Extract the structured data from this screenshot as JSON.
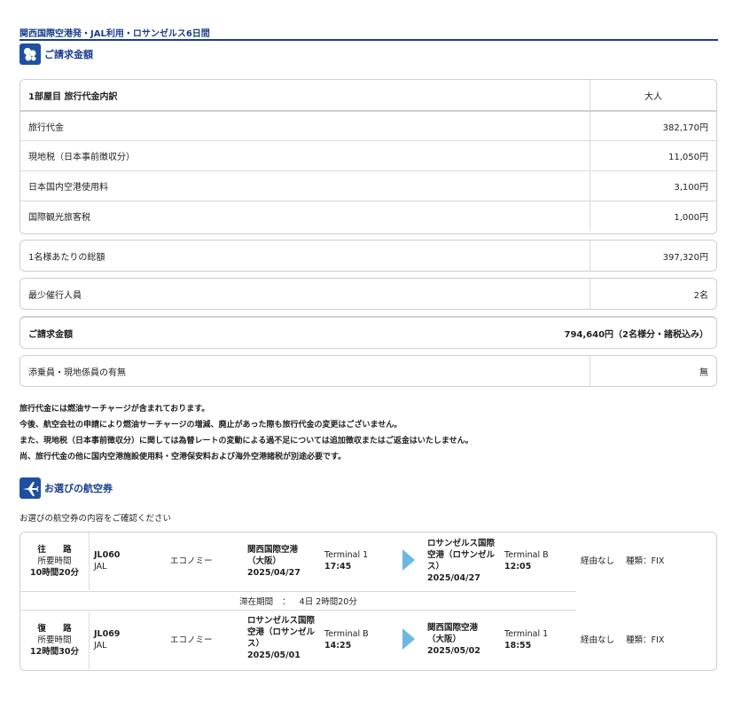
{
  "page_title": "関西国際空港発・JAL利用・ロサンゼルス6日間",
  "billing": {
    "title": "ご請求金額",
    "header": {
      "label": "1部屋目 旅行代金内訳",
      "value": "大人"
    },
    "items": [
      {
        "label": "旅行代金",
        "value": "382,170円"
      },
      {
        "label": "現地税（日本事前徴収分）",
        "value": "11,050円"
      },
      {
        "label": "日本国内空港使用料",
        "value": "3,100円"
      },
      {
        "label": "国際観光旅客税",
        "value": "1,000円"
      }
    ],
    "per_person": {
      "label": "1名様あたりの総額",
      "value": "397,320円"
    },
    "min_people": {
      "label": "最少催行人員",
      "value": "2名"
    },
    "total": {
      "label": "ご請求金額",
      "value": "794,640円（2名様分・諸税込み）"
    },
    "escort": {
      "label": "添乗員・現地係員の有無",
      "value": "無"
    }
  },
  "notes": [
    "旅行代金には燃油サーチャージが含まれております。",
    "今後、航空会社の申請により燃油サーチャージの増減、廃止があった際も旅行代金の変更はございません。",
    "また、現地税（日本事前徴収分）に関しては為替レートの変動による過不足については追加徴収またはご返金はいたしません。",
    "尚、旅行代金の他に国内空港施設使用料・空港保安料および海外空港諸税が別途必要です。"
  ],
  "flights": {
    "title": "お選びの航空券",
    "subtitle": "お選びの航空券の内容をご確認ください",
    "outbound": {
      "direction": "往 路",
      "duration_label": "所要時間",
      "duration": "10時間20分",
      "flight_no": "JL060",
      "airline": "JAL",
      "class": "エコノミー",
      "dep_airport": "関西国際空港（大阪）",
      "dep_date": "2025/04/27",
      "dep_terminal": "Terminal 1",
      "dep_time": "17:45",
      "arr_airport": "ロサンゼルス国際空港（ロサンゼルス）",
      "arr_date": "2025/04/27",
      "arr_terminal": "Terminal B",
      "arr_time": "12:05",
      "via": "経由なし",
      "fare_type": "種類：FIX"
    },
    "stay": {
      "label": "滞在期間",
      "colon": "：",
      "value": "4日 2時間20分"
    },
    "inbound": {
      "direction": "復 路",
      "duration_label": "所要時間",
      "duration": "12時間30分",
      "flight_no": "JL069",
      "airline": "JAL",
      "class": "エコノミー",
      "dep_airport": "ロサンゼルス国際空港（ロサンゼルス）",
      "dep_date": "2025/05/01",
      "dep_terminal": "Terminal B",
      "dep_time": "14:25",
      "arr_airport": "関西国際空港（大阪）",
      "arr_date": "2025/05/02",
      "arr_terminal": "Terminal 1",
      "arr_time": "18:55",
      "via": "経由なし",
      "fare_type": "種類：FIX"
    }
  },
  "colors": {
    "accent": "#1a3d8f",
    "icon_bg": "#1f4fa0",
    "arrow": "#6db7e3",
    "border": "#cfcfcf"
  },
  "icons": {
    "billing": "coins-icon",
    "flights": "airplane-icon",
    "flight_arrow": "arrow-right-icon"
  }
}
